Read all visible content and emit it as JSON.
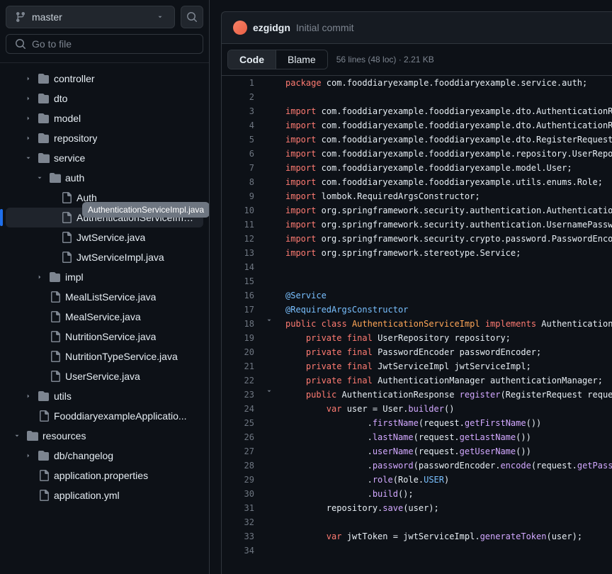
{
  "branch": {
    "name": "master"
  },
  "search": {
    "placeholder": "Go to file"
  },
  "tree": {
    "tooltip": "AuthenticationServiceImpl.java",
    "items": [
      {
        "type": "folder",
        "label": "controller",
        "depth": 1,
        "chev": "right"
      },
      {
        "type": "folder",
        "label": "dto",
        "depth": 1,
        "chev": "right"
      },
      {
        "type": "folder",
        "label": "model",
        "depth": 1,
        "chev": "right"
      },
      {
        "type": "folder",
        "label": "repository",
        "depth": 1,
        "chev": "right"
      },
      {
        "type": "folder-open",
        "label": "service",
        "depth": 1,
        "chev": "down"
      },
      {
        "type": "folder-open",
        "label": "auth",
        "depth": 2,
        "chev": "down"
      },
      {
        "type": "file",
        "label": "AuthenticationService.java",
        "shown": "Auth",
        "depth": 3
      },
      {
        "type": "file",
        "label": "AuthenticationServiceImpl...",
        "depth": 3,
        "selected": true
      },
      {
        "type": "file",
        "label": "JwtService.java",
        "depth": 3
      },
      {
        "type": "file",
        "label": "JwtServiceImpl.java",
        "depth": 3
      },
      {
        "type": "folder",
        "label": "impl",
        "depth": 2,
        "chev": "right"
      },
      {
        "type": "file",
        "label": "MealListService.java",
        "depth": 2
      },
      {
        "type": "file",
        "label": "MealService.java",
        "depth": 2
      },
      {
        "type": "file",
        "label": "NutritionService.java",
        "depth": 2
      },
      {
        "type": "file",
        "label": "NutritionTypeService.java",
        "depth": 2
      },
      {
        "type": "file",
        "label": "UserService.java",
        "depth": 2
      },
      {
        "type": "folder",
        "label": "utils",
        "depth": 1,
        "chev": "right"
      },
      {
        "type": "file",
        "label": "FooddiaryexampleApplicatio...",
        "depth": 1
      },
      {
        "type": "folder-open",
        "label": "resources",
        "depth": 0,
        "chev": "down"
      },
      {
        "type": "folder",
        "label": "db/changelog",
        "depth": 1,
        "chev": "right"
      },
      {
        "type": "file",
        "label": "application.properties",
        "depth": 1
      },
      {
        "type": "file",
        "label": "application.yml",
        "depth": 1
      }
    ]
  },
  "commit": {
    "user": "ezgidgn",
    "message": "Initial commit"
  },
  "tabs": {
    "code": "Code",
    "blame": "Blame"
  },
  "fileinfo": "56 lines (48 loc) · 2.21 KB",
  "code": [
    {
      "n": 1,
      "tokens": [
        [
          "k-red",
          "package"
        ],
        [
          "k-gray",
          " com.fooddiaryexample.fooddiaryexample.service.auth;"
        ]
      ]
    },
    {
      "n": 2,
      "tokens": []
    },
    {
      "n": 3,
      "tokens": [
        [
          "k-red",
          "import"
        ],
        [
          "k-gray",
          " com.fooddiaryexample.fooddiaryexample.dto.AuthenticationRe"
        ]
      ]
    },
    {
      "n": 4,
      "tokens": [
        [
          "k-red",
          "import"
        ],
        [
          "k-gray",
          " com.fooddiaryexample.fooddiaryexample.dto.AuthenticationRe"
        ]
      ]
    },
    {
      "n": 5,
      "tokens": [
        [
          "k-red",
          "import"
        ],
        [
          "k-gray",
          " com.fooddiaryexample.fooddiaryexample.dto.RegisterRequest;"
        ]
      ]
    },
    {
      "n": 6,
      "tokens": [
        [
          "k-red",
          "import"
        ],
        [
          "k-gray",
          " com.fooddiaryexample.fooddiaryexample.repository.UserRepos"
        ]
      ]
    },
    {
      "n": 7,
      "tokens": [
        [
          "k-red",
          "import"
        ],
        [
          "k-gray",
          " com.fooddiaryexample.fooddiaryexample.model.User;"
        ]
      ]
    },
    {
      "n": 8,
      "tokens": [
        [
          "k-red",
          "import"
        ],
        [
          "k-gray",
          " com.fooddiaryexample.fooddiaryexample.utils.enums.Role;"
        ]
      ]
    },
    {
      "n": 9,
      "tokens": [
        [
          "k-red",
          "import"
        ],
        [
          "k-gray",
          " lombok.RequiredArgsConstructor;"
        ]
      ]
    },
    {
      "n": 10,
      "tokens": [
        [
          "k-red",
          "import"
        ],
        [
          "k-gray",
          " org.springframework.security.authentication.Authenticatio"
        ]
      ]
    },
    {
      "n": 11,
      "tokens": [
        [
          "k-red",
          "import"
        ],
        [
          "k-gray",
          " org.springframework.security.authentication.UsernamePassw"
        ]
      ]
    },
    {
      "n": 12,
      "tokens": [
        [
          "k-red",
          "import"
        ],
        [
          "k-gray",
          " org.springframework.security.crypto.password.PasswordEnco"
        ]
      ]
    },
    {
      "n": 13,
      "tokens": [
        [
          "k-red",
          "import"
        ],
        [
          "k-gray",
          " org.springframework.stereotype.Service;"
        ]
      ]
    },
    {
      "n": 14,
      "tokens": []
    },
    {
      "n": 15,
      "tokens": []
    },
    {
      "n": 16,
      "tokens": [
        [
          "k-blue",
          "@Service"
        ]
      ]
    },
    {
      "n": 17,
      "tokens": [
        [
          "k-blue",
          "@RequiredArgsConstructor"
        ]
      ]
    },
    {
      "n": 18,
      "fold": "v",
      "tokens": [
        [
          "k-red",
          "public"
        ],
        [
          "k-gray",
          " "
        ],
        [
          "k-red",
          "class"
        ],
        [
          "k-gray",
          " "
        ],
        [
          "k-orange",
          "AuthenticationServiceImpl"
        ],
        [
          "k-gray",
          " "
        ],
        [
          "k-red",
          "implements"
        ],
        [
          "k-gray",
          " AuthenticationS"
        ]
      ]
    },
    {
      "n": 19,
      "tokens": [
        [
          "k-gray",
          "    "
        ],
        [
          "k-red",
          "private"
        ],
        [
          "k-gray",
          " "
        ],
        [
          "k-red",
          "final"
        ],
        [
          "k-gray",
          " UserRepository repository;"
        ]
      ]
    },
    {
      "n": 20,
      "tokens": [
        [
          "k-gray",
          "    "
        ],
        [
          "k-red",
          "private"
        ],
        [
          "k-gray",
          " "
        ],
        [
          "k-red",
          "final"
        ],
        [
          "k-gray",
          " PasswordEncoder passwordEncoder;"
        ]
      ]
    },
    {
      "n": 21,
      "tokens": [
        [
          "k-gray",
          "    "
        ],
        [
          "k-red",
          "private"
        ],
        [
          "k-gray",
          " "
        ],
        [
          "k-red",
          "final"
        ],
        [
          "k-gray",
          " JwtServiceImpl jwtServiceImpl;"
        ]
      ]
    },
    {
      "n": 22,
      "tokens": [
        [
          "k-gray",
          "    "
        ],
        [
          "k-red",
          "private"
        ],
        [
          "k-gray",
          " "
        ],
        [
          "k-red",
          "final"
        ],
        [
          "k-gray",
          " AuthenticationManager authenticationManager;"
        ]
      ]
    },
    {
      "n": 23,
      "fold": "v",
      "tokens": [
        [
          "k-gray",
          "    "
        ],
        [
          "k-red",
          "public"
        ],
        [
          "k-gray",
          " AuthenticationResponse "
        ],
        [
          "k-purple",
          "register"
        ],
        [
          "k-gray",
          "(RegisterRequest reques"
        ]
      ]
    },
    {
      "n": 24,
      "tokens": [
        [
          "k-gray",
          "        "
        ],
        [
          "k-red",
          "var"
        ],
        [
          "k-gray",
          " user = User."
        ],
        [
          "k-purple",
          "builder"
        ],
        [
          "k-gray",
          "()"
        ]
      ]
    },
    {
      "n": 25,
      "tokens": [
        [
          "k-gray",
          "                ."
        ],
        [
          "k-purple",
          "firstName"
        ],
        [
          "k-gray",
          "(request."
        ],
        [
          "k-purple",
          "getFirstName"
        ],
        [
          "k-gray",
          "())"
        ]
      ]
    },
    {
      "n": 26,
      "tokens": [
        [
          "k-gray",
          "                ."
        ],
        [
          "k-purple",
          "lastName"
        ],
        [
          "k-gray",
          "(request."
        ],
        [
          "k-purple",
          "getLastName"
        ],
        [
          "k-gray",
          "())"
        ]
      ]
    },
    {
      "n": 27,
      "tokens": [
        [
          "k-gray",
          "                ."
        ],
        [
          "k-purple",
          "userName"
        ],
        [
          "k-gray",
          "(request."
        ],
        [
          "k-purple",
          "getUserName"
        ],
        [
          "k-gray",
          "())"
        ]
      ]
    },
    {
      "n": 28,
      "tokens": [
        [
          "k-gray",
          "                ."
        ],
        [
          "k-purple",
          "password"
        ],
        [
          "k-gray",
          "(passwordEncoder."
        ],
        [
          "k-purple",
          "encode"
        ],
        [
          "k-gray",
          "(request."
        ],
        [
          "k-purple",
          "getPass"
        ]
      ]
    },
    {
      "n": 29,
      "tokens": [
        [
          "k-gray",
          "                ."
        ],
        [
          "k-purple",
          "role"
        ],
        [
          "k-gray",
          "(Role."
        ],
        [
          "k-blue",
          "USER"
        ],
        [
          "k-gray",
          ")"
        ]
      ]
    },
    {
      "n": 30,
      "tokens": [
        [
          "k-gray",
          "                ."
        ],
        [
          "k-purple",
          "build"
        ],
        [
          "k-gray",
          "();"
        ]
      ]
    },
    {
      "n": 31,
      "tokens": [
        [
          "k-gray",
          "        repository."
        ],
        [
          "k-purple",
          "save"
        ],
        [
          "k-gray",
          "(user);"
        ]
      ]
    },
    {
      "n": 32,
      "tokens": []
    },
    {
      "n": 33,
      "tokens": [
        [
          "k-gray",
          "        "
        ],
        [
          "k-red",
          "var"
        ],
        [
          "k-gray",
          " jwtToken = jwtServiceImpl."
        ],
        [
          "k-purple",
          "generateToken"
        ],
        [
          "k-gray",
          "(user);"
        ]
      ]
    },
    {
      "n": 34,
      "tokens": []
    }
  ]
}
